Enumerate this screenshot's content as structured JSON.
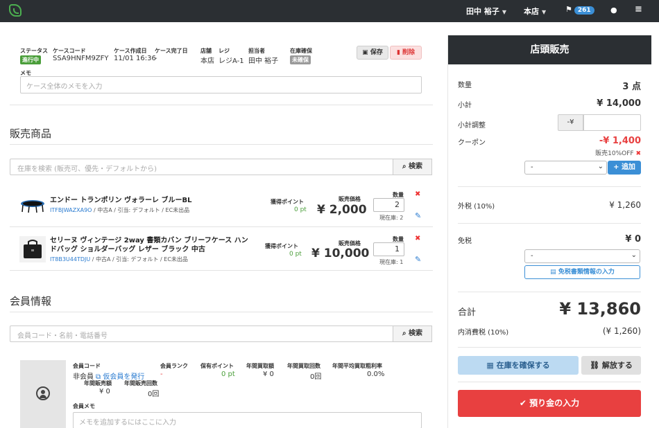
{
  "topbar": {
    "user_name": "田中 裕子",
    "store": "本店",
    "notification_count": "261"
  },
  "case": {
    "status_label": "ステータス",
    "status_value": "進行中",
    "code_label": "ケースコード",
    "code_value": "SSA9HNFM9ZFY",
    "created_label": "ケース作成日",
    "created_value": "11/01 16:36",
    "completed_label": "ケース完了日",
    "completed_value": "-",
    "store_label": "店舗",
    "store_value": "本店",
    "register_label": "レジ",
    "register_value": "レジA-1",
    "staff_label": "担当者",
    "staff_value": "田中 裕子",
    "reserve_label": "在庫確保",
    "reserve_value": "未確保",
    "save_label": "保存",
    "delete_label": "削除",
    "memo_label": "メモ",
    "memo_placeholder": "ケース全体のメモを入力"
  },
  "sales": {
    "heading": "販売商品",
    "search_placeholder": "在庫を検索 (販売可、優先・デフォルトから)",
    "search_button": "検索",
    "points_label": "獲得ポイント",
    "price_label": "販売価格",
    "qty_label": "数量",
    "items": [
      {
        "name_line1": "エンドー トランポリン ヴォラーレ ブルーBL",
        "name_line2": "",
        "code": "ITFBJWAZXA9O",
        "meta": " / 中古A / 引当: デフォルト / EC未出品",
        "points": "0 pt",
        "price": "¥ 2,000",
        "qty": "2",
        "stock": "現在庫: 2"
      },
      {
        "name_line1": "セリーヌ ヴィンテージ 2way 書類カバン ブリーフケース ハン",
        "name_line2": "ドバッグ ショルダーバッグ レザー ブラック 中古",
        "code": "IT8B3U44TDJU",
        "meta": " / 中古A / 引当: デフォルト / EC未出品",
        "points": "0 pt",
        "price": "¥ 10,000",
        "qty": "1",
        "stock": "現在庫: 1"
      }
    ]
  },
  "member": {
    "heading": "会員情報",
    "search_placeholder": "会員コード・名前・電話番号",
    "search_button": "検索",
    "code_label": "会員コード",
    "code_value": "非会員",
    "issue_link": "仮会員を発行",
    "rank_label": "会員ランク",
    "rank_value": "-",
    "points_label": "保有ポイント",
    "points_value": "0 pt",
    "annual_buy_label": "年間買取額",
    "annual_buy_value": "¥ 0",
    "annual_buy_count_label": "年間買取回数",
    "annual_buy_count_value": "0回",
    "margin_label": "年間平均買取粗利率",
    "margin_value": "0.0%",
    "annual_sales_label": "年間販売額",
    "annual_sales_value": "¥ 0",
    "annual_sales_count_label": "年間販売回数",
    "annual_sales_count_value": "0回",
    "memo_label": "会員メモ",
    "memo_placeholder": "メモを追加するにはここに入力"
  },
  "panel": {
    "title": "店頭販売",
    "qty_label": "数量",
    "qty_value": "3 点",
    "subtotal_label": "小計",
    "subtotal_value": "¥ 14,000",
    "adjust_label": "小計調整",
    "adjust_prefix": "-¥",
    "coupon_label": "クーポン",
    "coupon_value": "-¥ 1,400",
    "coupon_note": "販売10%OFF",
    "coupon_select": "-",
    "add_button": "追加",
    "ext_tax_label": "外税 (10%)",
    "ext_tax_value": "¥ 1,260",
    "taxfree_label": "免税",
    "taxfree_value": "¥ 0",
    "taxfree_select": "-",
    "taxfree_button": "免税書類情報の入力",
    "total_label": "合計",
    "total_value": "¥ 13,860",
    "incl_tax_label": "内消費税 (10%)",
    "incl_tax_value": "(¥ 1,260)",
    "reserve_button": "在庫を確保する",
    "release_button": "解放する",
    "deposit_button": "預り金の入力"
  },
  "colors": {
    "topbar": "#2b2f33",
    "accent": "#3b8fd6",
    "status_green": "#4a9e3a",
    "danger": "#e84040"
  }
}
